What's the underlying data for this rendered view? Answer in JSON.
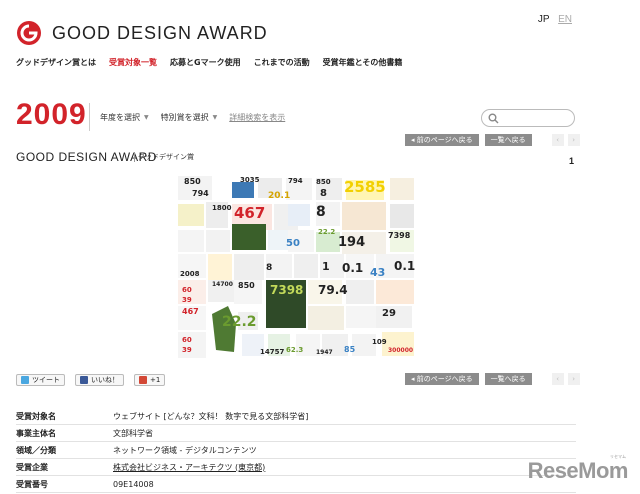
{
  "header": {
    "logo_text": "GOOD DESIGN AWARD",
    "lang": {
      "jp": "JP",
      "en": "EN"
    }
  },
  "nav": {
    "items": [
      "グッドデザイン賞とは",
      "受賞対象一覧",
      "応募とGマーク使用",
      "これまでの活動",
      "受賞年鑑とその他書籍"
    ],
    "active_index": 1
  },
  "year_bar": {
    "year": "2009",
    "filters": [
      "年度を選択",
      "特別賞を選択"
    ],
    "advanced": "詳細検索を表示"
  },
  "pager": {
    "prev": "◂ 前のページへ戻る",
    "list": "一覧へ戻る",
    "left_arrow": "‹",
    "right_arrow": "›"
  },
  "award": {
    "title": "GOOD DESIGN AWARD",
    "subtitle": "グッドデザイン賞",
    "count": "1"
  },
  "social": {
    "tweet": "ツイート",
    "like": "いいね！",
    "plus": "+1"
  },
  "details": [
    {
      "key": "受賞対象名",
      "value": "ウェブサイト [どんな？文科！ 数字で見る文部科学省]",
      "link": false
    },
    {
      "key": "事業主体名",
      "value": "文部科学省",
      "link": false
    },
    {
      "key": "領域／分類",
      "value": "ネットワーク領域 - デジタルコンテンツ",
      "link": false
    },
    {
      "key": "受賞企業",
      "value": "株式会社ビジネス・アーキテクツ (東京都)",
      "link": true
    },
    {
      "key": "受賞番号",
      "value": "09E14008",
      "link": false
    }
  ],
  "watermark": {
    "text": "ReseMom",
    "small": "リセマム"
  },
  "colors": {
    "brand_red": "#d2232a",
    "button_gray": "#8c8c8c"
  }
}
